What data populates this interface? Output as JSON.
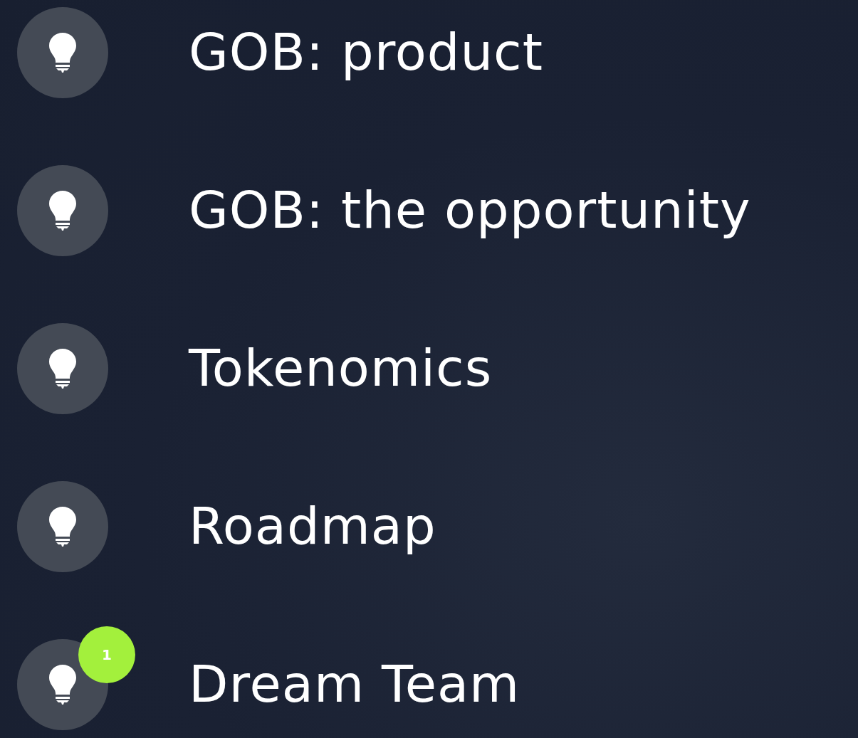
{
  "items": [
    {
      "label": "GOB: product"
    },
    {
      "label": "GOB: the opportunity"
    },
    {
      "label": "Tokenomics"
    },
    {
      "label": "Roadmap"
    },
    {
      "label": "Dream Team",
      "badge": "1"
    }
  ]
}
